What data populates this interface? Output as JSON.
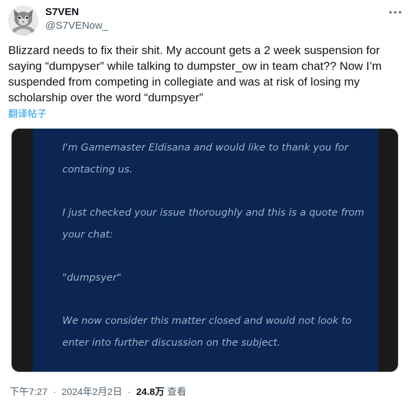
{
  "author": {
    "display_name": "S7VEN",
    "handle": "@S7VENow_",
    "avatar_icon": "cat-avatar-icon"
  },
  "menu": {
    "icon": "more-options-icon"
  },
  "tweet": {
    "lines": [
      "Blizzard needs to fix their shit. My account gets a 2 week suspension for",
      "saying “dumpyser” while talking to dumpster_ow in team chat?? Now I’m",
      "suspended from competing in collegiate and was at risk of losing my",
      "scholarship over the word “dumpsyer”"
    ],
    "translate_label": "翻译帖子"
  },
  "media": {
    "background_color": "#0b2652",
    "text_color": "#9eb0cc",
    "lines": [
      "I'm Gamemaster Eldisana and would like to thank you for",
      "contacting us.",
      "I just checked your issue thoroughly and this is a quote from",
      "your chat:",
      "\"dumpsyer\"",
      "We now consider this matter closed and would not look to",
      "enter into further discussion on the subject."
    ]
  },
  "meta": {
    "time": "下午7:27",
    "date": "2024年2月2日",
    "separator": "·",
    "views_count": "24.8万",
    "views_label": "查看"
  },
  "colors": {
    "link": "#1d9bf0",
    "secondary_text": "#536471",
    "primary_text": "#0f1419"
  }
}
